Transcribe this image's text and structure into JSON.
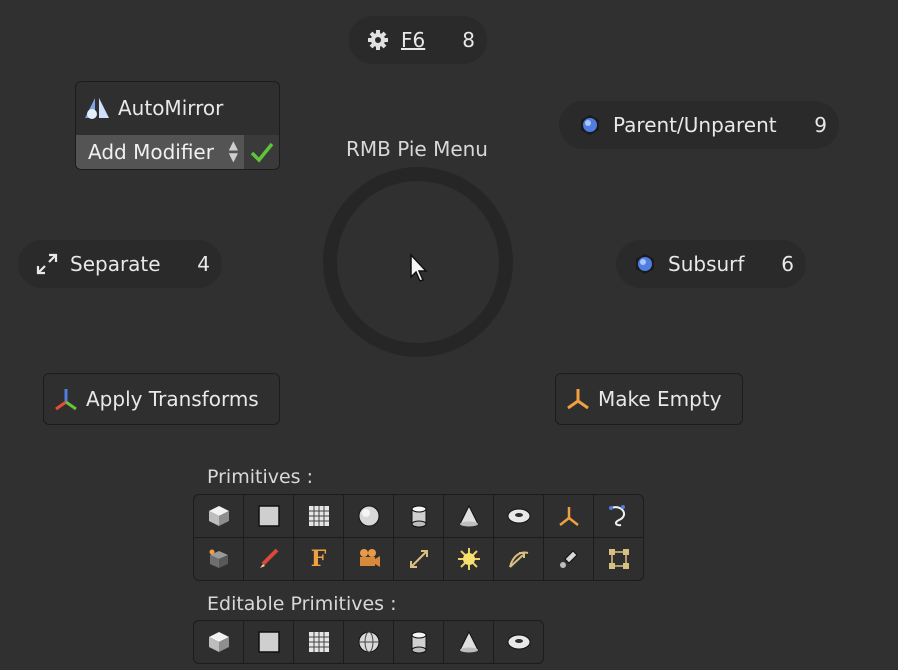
{
  "pie": {
    "title": "RMB Pie Menu",
    "top": {
      "label": "F6",
      "key": "8",
      "icon": "gear-icon"
    },
    "top_right": {
      "label": "Parent/Unparent",
      "key": "9",
      "icon": "blue-sphere-icon"
    },
    "left": {
      "label": "Separate",
      "key": "4",
      "icon": "expand-arrows-icon"
    },
    "right": {
      "label": "Subsurf",
      "key": "6",
      "icon": "blue-sphere-icon"
    },
    "bottom_left": {
      "label": "Apply Transforms",
      "icon": "axes-icon"
    },
    "bottom_right": {
      "label": "Make Empty",
      "icon": "empty-axes-icon"
    }
  },
  "automirror": {
    "title": "AutoMirror",
    "select_label": "Add Modifier",
    "icon": "automirror-icon"
  },
  "primitives": {
    "label": "Primitives :",
    "row1": [
      "cube-icon",
      "plane-icon",
      "grid-icon",
      "uv-sphere-icon",
      "cylinder-icon",
      "cone-icon",
      "torus-icon",
      "empty-icon",
      "curve-icon"
    ],
    "row2": [
      "cube-origin-icon",
      "grease-pencil-icon",
      "text-icon",
      "camera-icon",
      "armature-icon",
      "lamp-icon",
      "force-field-icon",
      "speaker-icon",
      "lattice-icon"
    ]
  },
  "editable": {
    "label": "Editable Primitives :",
    "row": [
      "cube-icon",
      "plane-icon",
      "grid-icon",
      "ico-sphere-icon",
      "cylinder-icon",
      "cone-icon",
      "torus-icon"
    ]
  }
}
